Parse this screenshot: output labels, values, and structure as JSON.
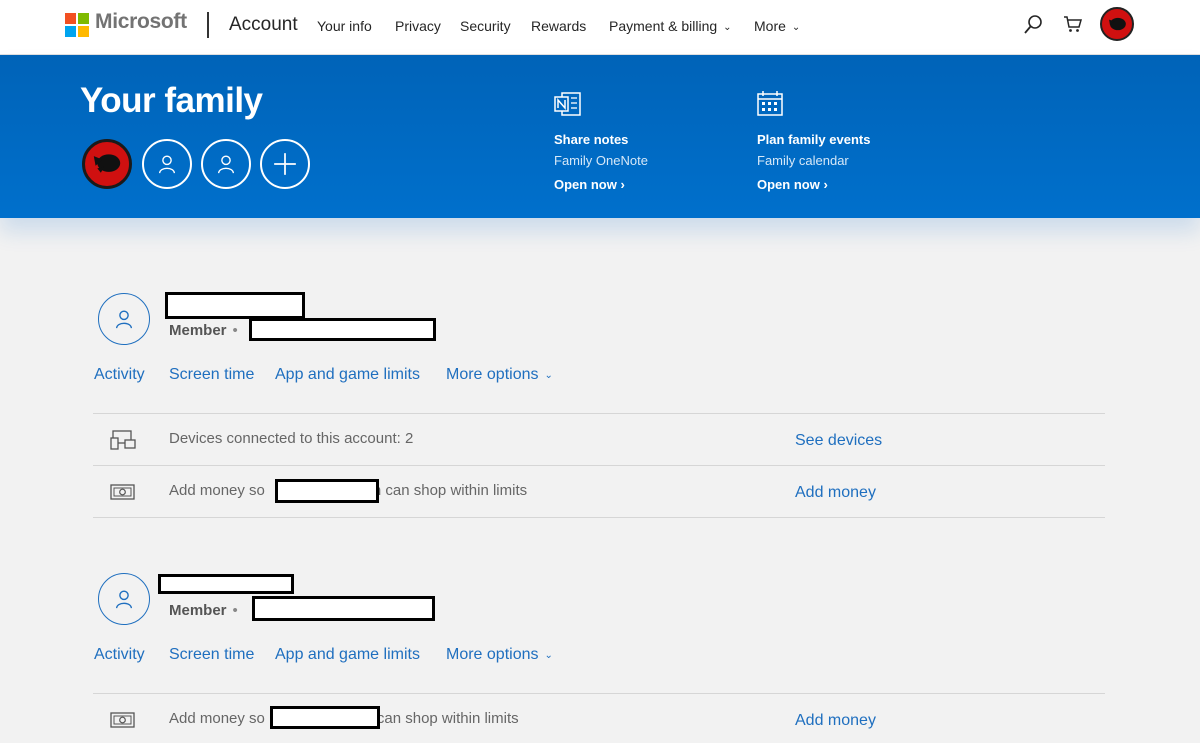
{
  "header": {
    "brand": "Microsoft",
    "section": "Account",
    "nav": [
      {
        "label": "Your info"
      },
      {
        "label": "Privacy"
      },
      {
        "label": "Security"
      },
      {
        "label": "Rewards"
      },
      {
        "label": "Payment & billing",
        "has_dropdown": true
      },
      {
        "label": "More",
        "has_dropdown": true
      }
    ],
    "icons": [
      "search-icon",
      "cart-icon"
    ]
  },
  "banner": {
    "title": "Your family",
    "promos": [
      {
        "title": "Share notes",
        "subtitle": "Family OneNote",
        "link": "Open now",
        "icon": "onenote-icon"
      },
      {
        "title": "Plan family events",
        "subtitle": "Family calendar",
        "link": "Open now",
        "icon": "calendar-icon"
      }
    ]
  },
  "members": [
    {
      "role": "Member",
      "tabs": [
        "Activity",
        "Screen time",
        "App and game limits",
        "More options"
      ],
      "rows": [
        {
          "text": "Devices connected to this account: 2",
          "link": "See devices",
          "icon": "devices-icon"
        },
        {
          "text_before": "Add money so",
          "text_after": "n can shop within limits",
          "link": "Add money",
          "icon": "money-icon"
        }
      ]
    },
    {
      "role": "Member",
      "tabs": [
        "Activity",
        "Screen time",
        "App and game limits",
        "More options"
      ],
      "rows": [
        {
          "text_before": "Add money so",
          "text_after": "can shop within limits",
          "link": "Add money",
          "icon": "money-icon"
        }
      ]
    }
  ],
  "colors": {
    "banner": "#0067c0",
    "link": "#1f6fbf",
    "background": "#f2f2f2"
  }
}
